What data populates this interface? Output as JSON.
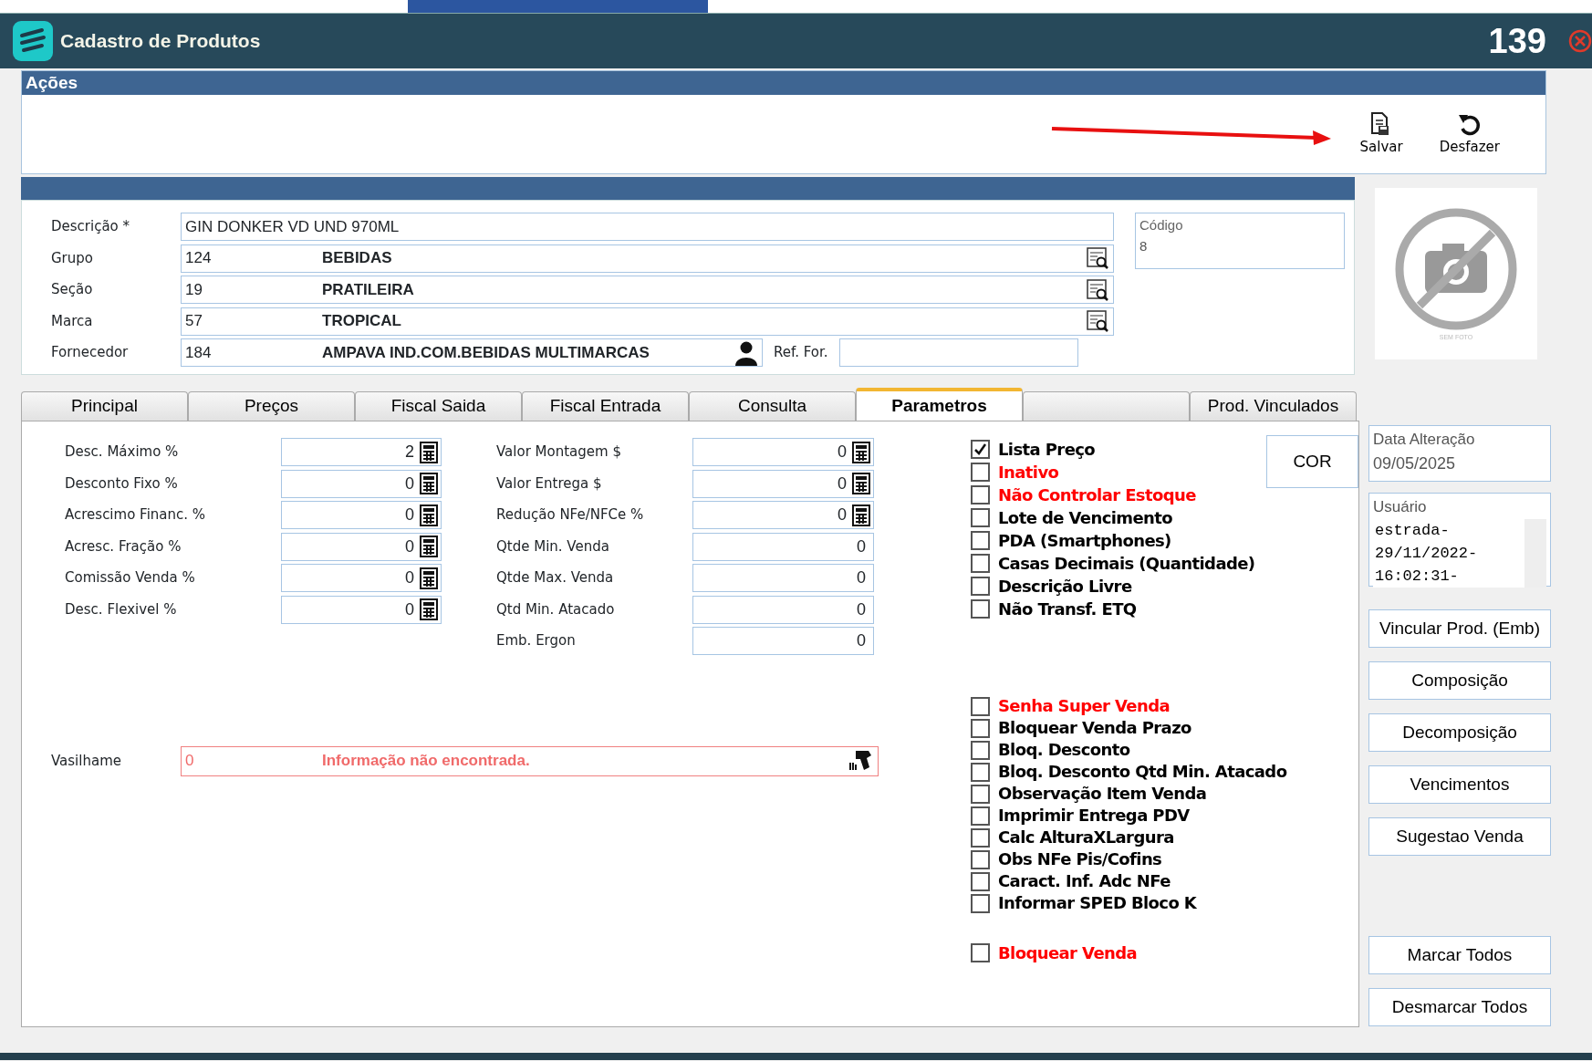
{
  "window": {
    "title": "Cadastro de Produtos",
    "number": "139"
  },
  "actions": {
    "title": "Ações",
    "buttons": [
      {
        "label": "Salvar",
        "kind": "save"
      },
      {
        "label": "Desfazer",
        "kind": "undo"
      }
    ]
  },
  "product": {
    "fields": [
      {
        "kind": "text",
        "label": "Descrição *",
        "value": "GIN DONKER VD UND 970ML"
      },
      {
        "kind": "lookup",
        "label": "Grupo",
        "code": "124",
        "name": "BEBIDAS"
      },
      {
        "kind": "lookup",
        "label": "Seção",
        "code": "19",
        "name": "PRATILEIRA"
      },
      {
        "kind": "lookup",
        "label": "Marca",
        "code": "57",
        "name": "TROPICAL"
      },
      {
        "kind": "supplier",
        "label": "Fornecedor",
        "code": "184",
        "name": "AMPAVA IND.COM.BEBIDAS MULTIMARCAS",
        "ref_label": "Ref. For."
      }
    ],
    "codigo": {
      "label": "Código",
      "value": "8"
    },
    "photo": {
      "caption": "SEM FOTO"
    }
  },
  "tabs": [
    {
      "label": "Principal",
      "selected": false
    },
    {
      "label": "Preços",
      "selected": false
    },
    {
      "label": "Fiscal Saida",
      "selected": false
    },
    {
      "label": "Fiscal Entrada",
      "selected": false
    },
    {
      "label": "Consulta",
      "selected": false
    },
    {
      "label": "Parametros",
      "selected": true
    },
    {
      "selected": false
    },
    {
      "label": "Prod. Vinculados",
      "selected": false
    }
  ],
  "parameters": {
    "left": [
      {
        "label": "Desc. Máximo %",
        "value": "2",
        "kind": "calc"
      },
      {
        "label": "Desconto Fixo %",
        "value": "0",
        "kind": "calc"
      },
      {
        "label": "Acrescimo Financ. %",
        "value": "0",
        "kind": "calc"
      },
      {
        "label": "Acresc. Fração %",
        "value": "0",
        "kind": "calc"
      },
      {
        "label": "Comissão Venda %",
        "value": "0",
        "kind": "calc"
      },
      {
        "label": "Desc. Flexivel %",
        "value": "0",
        "kind": "calc"
      }
    ],
    "right": [
      {
        "label": "Valor Montagem $",
        "value": "0",
        "kind": "calc"
      },
      {
        "label": "Valor Entrega $",
        "value": "0",
        "kind": "calc"
      },
      {
        "label": "Redução NFe/NFCe %",
        "value": "0",
        "kind": "calc"
      },
      {
        "label": "Qtde Min. Venda",
        "value": "0",
        "kind": "plain"
      },
      {
        "label": "Qtde Max. Venda",
        "value": "0",
        "kind": "plain"
      },
      {
        "label": "Qtd Min. Atacado",
        "value": "0",
        "kind": "plain"
      },
      {
        "label": "Emb. Ergon",
        "value": "0",
        "kind": "plain"
      }
    ]
  },
  "options": [
    [
      {
        "label": "Lista  Preço",
        "checked": true,
        "color": "#000000"
      },
      {
        "label": "Inativo",
        "checked": false,
        "color": "#ff0000"
      },
      {
        "label": "Não Controlar Estoque",
        "checked": false,
        "color": "#ff0000"
      },
      {
        "label": "Lote de Vencimento",
        "checked": false,
        "color": "#000000"
      },
      {
        "label": "PDA (Smartphones)",
        "checked": false,
        "color": "#000000"
      },
      {
        "label": "Casas Decimais (Quantidade)",
        "checked": false,
        "color": "#000000"
      },
      {
        "label": "Descrição Livre",
        "checked": false,
        "color": "#000000"
      },
      {
        "label": "Não Transf. ETQ",
        "checked": false,
        "color": "#000000"
      }
    ],
    [
      {
        "label": "Senha Super Venda",
        "checked": false,
        "color": "#ff0000"
      },
      {
        "label": "Bloquear Venda Prazo",
        "checked": false,
        "color": "#000000"
      },
      {
        "label": "Bloq. Desconto",
        "checked": false,
        "color": "#000000"
      },
      {
        "label": "Bloq. Desconto Qtd Min. Atacado",
        "checked": false,
        "color": "#000000"
      },
      {
        "label": "Observação Item Venda",
        "checked": false,
        "color": "#000000"
      },
      {
        "label": "Imprimir Entrega PDV",
        "checked": false,
        "color": "#000000"
      },
      {
        "label": "Calc AlturaXLargura",
        "checked": false,
        "color": "#000000"
      },
      {
        "label": "Obs NFe Pis/Cofins",
        "checked": false,
        "color": "#000000"
      },
      {
        "label": "Caract. Inf. Adc NFe",
        "checked": false,
        "color": "#000000"
      },
      {
        "label": "Informar SPED Bloco K",
        "checked": false,
        "color": "#000000"
      }
    ],
    [
      {
        "label": "Bloquear Venda",
        "checked": false,
        "color": "#ff0000"
      }
    ]
  ],
  "cor_button": "COR",
  "vasilhame": {
    "label": "Vasilhame",
    "code": "0",
    "message": "Informação não encontrada.",
    "error": true
  },
  "side": {
    "data_alteracao": {
      "label": "Data Alteração",
      "value": "09/05/2025"
    },
    "usuario": {
      "label": "Usuário",
      "lines": [
        "estrada-",
        "29/11/2022-",
        "16:02:31-"
      ]
    },
    "buttons": [
      "Vincular Prod. (Emb)",
      "Composição",
      "Decomposição",
      "Vencimentos",
      "Sugestao Venda"
    ],
    "bottom_buttons": [
      "Marcar Todos",
      "Desmarcar Todos"
    ]
  }
}
